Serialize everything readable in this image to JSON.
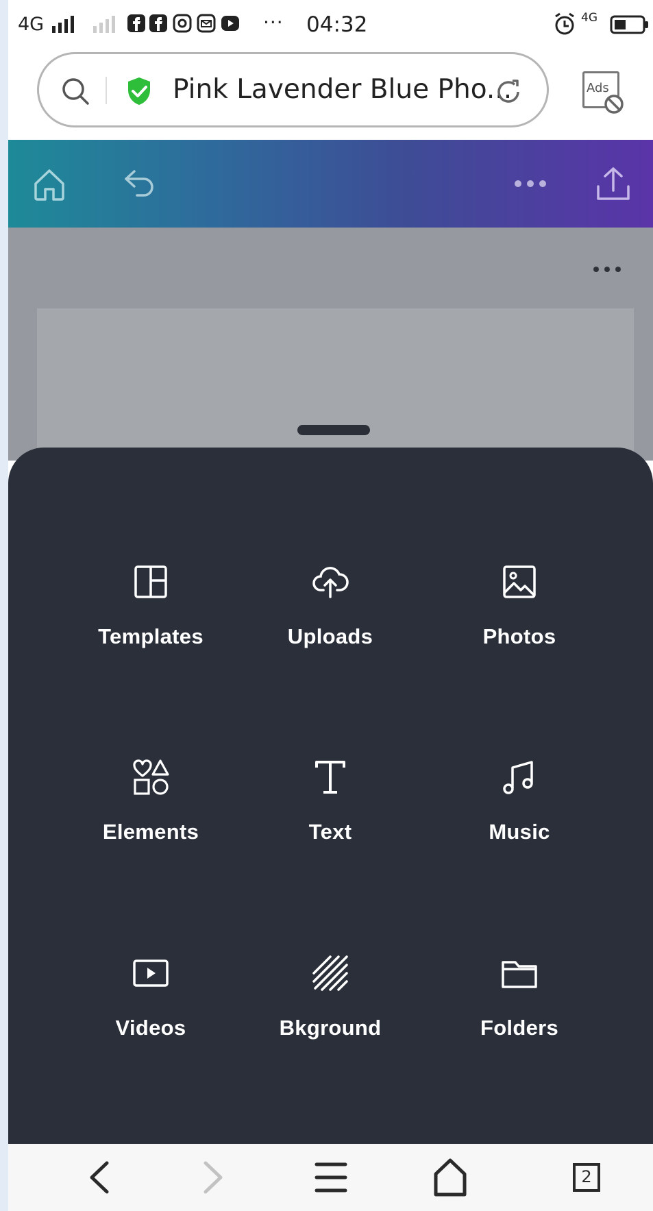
{
  "status_bar": {
    "network": "4G",
    "more": "···",
    "time": "04:32",
    "network_right": "4G"
  },
  "address_bar": {
    "title": "Pink Lavender Blue Pho...",
    "ads_label": "Ads"
  },
  "panel": {
    "items": [
      {
        "label": "Templates",
        "icon": "templates-icon"
      },
      {
        "label": "Uploads",
        "icon": "upload-cloud-icon"
      },
      {
        "label": "Photos",
        "icon": "photo-icon"
      },
      {
        "label": "Elements",
        "icon": "shapes-icon"
      },
      {
        "label": "Text",
        "icon": "text-icon"
      },
      {
        "label": "Music",
        "icon": "music-note-icon"
      },
      {
        "label": "Videos",
        "icon": "video-play-icon"
      },
      {
        "label": "Bkground",
        "icon": "background-stripes-icon"
      },
      {
        "label": "Folders",
        "icon": "folder-icon"
      }
    ]
  },
  "bottom_nav": {
    "tab_count": "2"
  },
  "colors": {
    "header_gradient_start": "#1e8a98",
    "header_gradient_end": "#5a34a8",
    "panel_bg": "#2a2f39",
    "canvas_bg": "#969aa0"
  }
}
